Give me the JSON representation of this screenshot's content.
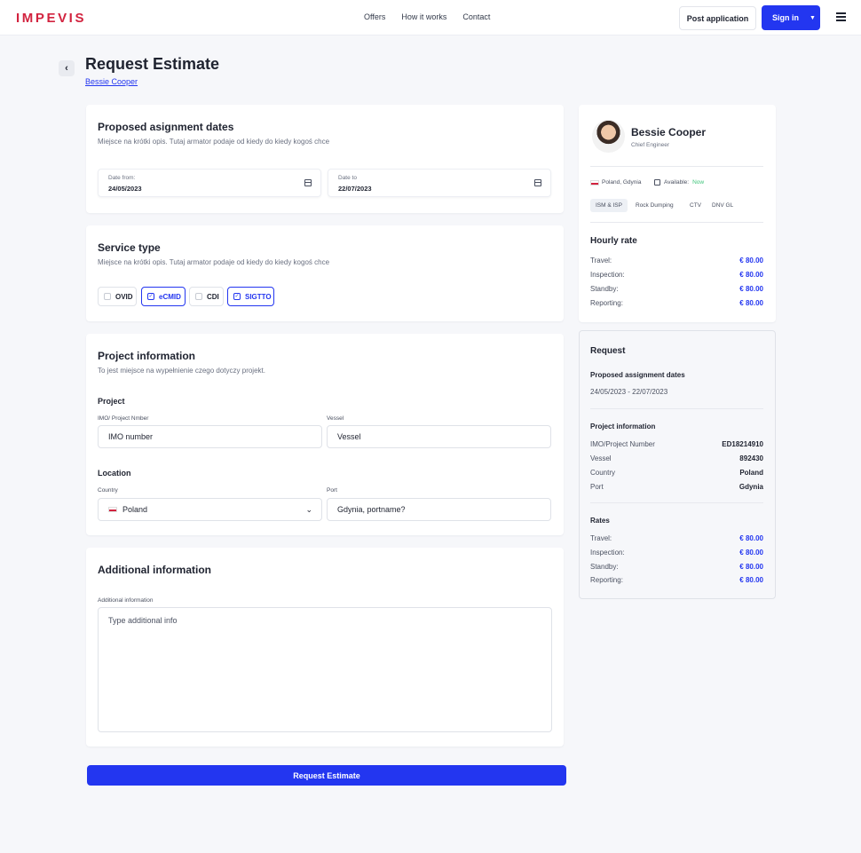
{
  "header": {
    "logo": "IMPEVIS",
    "nav": [
      "Offers",
      "How it works",
      "Contact"
    ],
    "post_label": "Post application",
    "sign_label": "Sign in"
  },
  "page": {
    "title": "Request Estimate",
    "subtitle": "Bessie Cooper"
  },
  "dates_card": {
    "title": "Proposed asignment dates",
    "desc": "Miejsce na krótki opis. Tutaj armator podaje od kiedy do kiedy kogoś chce",
    "from_label": "Date from:",
    "from_value": "24/05/2023",
    "to_label": "Date to",
    "to_value": "22/07/2023"
  },
  "service_card": {
    "title": "Service type",
    "desc": "Miejsce na krótki opis. Tutaj armator podaje od kiedy do kiedy kogoś chce",
    "options": [
      {
        "label": "OVID",
        "checked": false
      },
      {
        "label": "eCMID",
        "checked": true
      },
      {
        "label": "CDI",
        "checked": false
      },
      {
        "label": "SIGTTO",
        "checked": true
      }
    ]
  },
  "project_card": {
    "title": "Project information",
    "desc": "To jest miejsce na wypełnienie czego dotyczy projekt.",
    "project_section": "Project",
    "imo_label": "IMO/ Project Nmber",
    "imo_placeholder": "IMO number",
    "vessel_label": "Vessel",
    "vessel_placeholder": "Vessel",
    "location_section": "Location",
    "country_label": "Country",
    "country_value": "Poland",
    "port_label": "Port",
    "port_placeholder": "Gdynia, portname?"
  },
  "additional_card": {
    "title": "Additional information",
    "field_label": "Additional information",
    "placeholder": "Type additional info"
  },
  "submit_label": "Request Estimate",
  "profile": {
    "name": "Bessie Cooper",
    "role": "Chief Engineer",
    "location": "Poland, Gdynia",
    "available_label": "Available:",
    "available_value": "Now",
    "tags": [
      "ISM & ISP",
      "Rock Dumping",
      "CTV",
      "DNV GL"
    ],
    "rate_title": "Hourly rate",
    "rates": [
      {
        "label": "Travel:",
        "value": "€ 80.00"
      },
      {
        "label": "Inspection:",
        "value": "€ 80.00"
      },
      {
        "label": "Standby:",
        "value": "€ 80.00"
      },
      {
        "label": "Reporting:",
        "value": "€ 80.00"
      }
    ]
  },
  "request": {
    "title": "Request",
    "dates_title": "Proposed assignment dates",
    "dates_value": "24/05/2023 - 22/07/2023",
    "project_title": "Project information",
    "project_rows": [
      {
        "label": "IMO/Project Number",
        "value": "ED18214910"
      },
      {
        "label": "Vessel",
        "value": "892430"
      },
      {
        "label": "Country",
        "value": "Poland"
      },
      {
        "label": "Port",
        "value": "Gdynia"
      }
    ],
    "rates_title": "Rates",
    "rates": [
      {
        "label": "Travel:",
        "value": "€ 80.00"
      },
      {
        "label": "Inspection:",
        "value": "€ 80.00"
      },
      {
        "label": "Standby:",
        "value": "€ 80.00"
      },
      {
        "label": "Reporting:",
        "value": "€ 80.00"
      }
    ]
  },
  "colors": {
    "accent": "#2336f0",
    "brand": "#d2233f",
    "available": "#3ec47a"
  }
}
